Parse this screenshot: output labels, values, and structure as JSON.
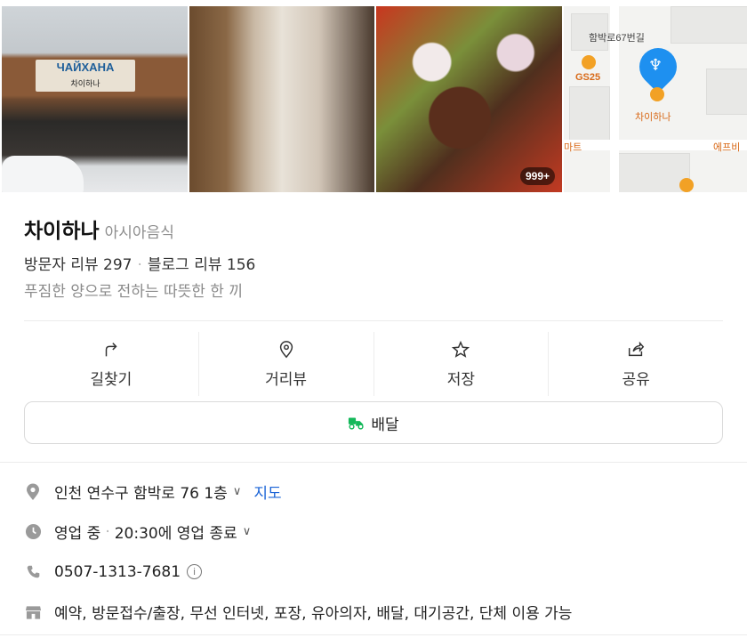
{
  "photos": {
    "storefront": {
      "sign_main": "ЧАЙХАНА",
      "sign_sub": "차이하나"
    },
    "more_count": "999+"
  },
  "map": {
    "street_label": "함박로67번길",
    "gs25_label": "GS25",
    "place_label": "차이하나",
    "mart_label": "마트",
    "efubi_label": "에프비"
  },
  "place": {
    "name": "차이하나",
    "category": "아시아음식",
    "visitor_review_label": "방문자 리뷰 297",
    "blog_review_label": "블로그 리뷰 156",
    "tagline": "푸짐한 양으로 전하는 따뜻한 한 끼"
  },
  "actions": [
    {
      "label": "길찾기",
      "icon": "directions-icon"
    },
    {
      "label": "거리뷰",
      "icon": "street-view-pin-icon"
    },
    {
      "label": "저장",
      "icon": "star-icon"
    },
    {
      "label": "공유",
      "icon": "share-icon"
    }
  ],
  "delivery_button": {
    "label": "배달"
  },
  "details": {
    "address": "인천 연수구 함박로 76 1층",
    "map_link": "지도",
    "status": "영업 중",
    "hours": "20:30에 영업 종료",
    "phone": "0507-1313-7681",
    "amenities": "예약, 방문접수/출장, 무선 인터넷, 포장, 유아의자, 배달, 대기공간, 단체 이용 가능"
  },
  "colors": {
    "accent": "#1a63d6",
    "delivery_green": "#14b85a",
    "map_pin": "#1e90f0",
    "poi_orange": "#f2a125"
  }
}
